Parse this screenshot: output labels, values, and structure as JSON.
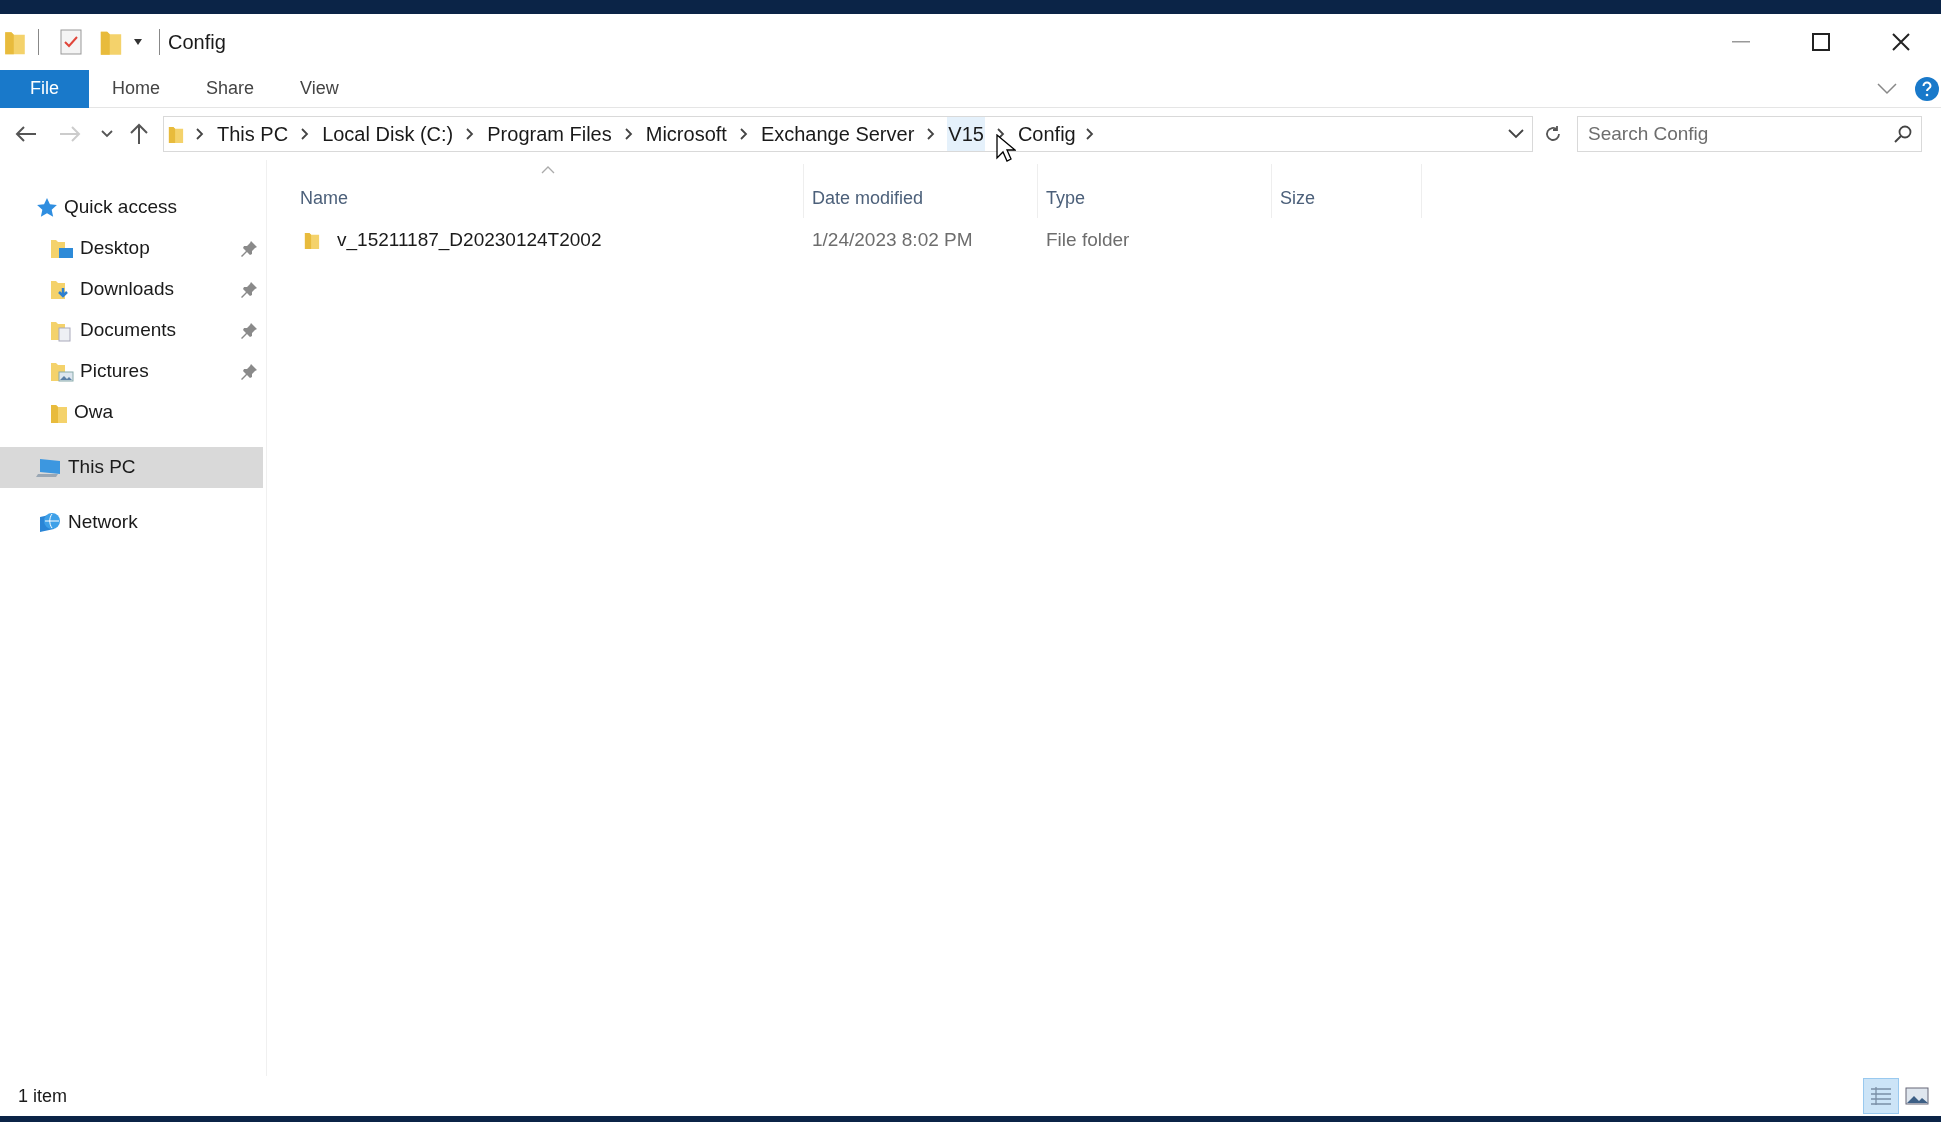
{
  "window": {
    "title": "Config"
  },
  "ribbon_tabs": [
    {
      "label": "File",
      "selected": true
    },
    {
      "label": "Home",
      "selected": false
    },
    {
      "label": "Share",
      "selected": false
    },
    {
      "label": "View",
      "selected": false
    }
  ],
  "address_bar": {
    "crumbs": [
      {
        "label": "This PC",
        "hovered": false
      },
      {
        "label": "Local Disk (C:)",
        "hovered": false
      },
      {
        "label": "Program Files",
        "hovered": false
      },
      {
        "label": "Microsoft",
        "hovered": false
      },
      {
        "label": "Exchange Server",
        "hovered": false
      },
      {
        "label": "V15",
        "hovered": true
      },
      {
        "label": "Config",
        "hovered": false
      }
    ],
    "search": {
      "placeholder": "Search Config"
    }
  },
  "sidebar": {
    "items": [
      {
        "label": "Quick access",
        "kind": "star",
        "selected": false,
        "children": [
          {
            "label": "Desktop",
            "kind": "desktop",
            "pinned": true,
            "selected": false
          },
          {
            "label": "Downloads",
            "kind": "downloads",
            "pinned": true,
            "selected": false
          },
          {
            "label": "Documents",
            "kind": "documents",
            "pinned": true,
            "selected": false
          },
          {
            "label": "Pictures",
            "kind": "pictures",
            "pinned": true,
            "selected": false
          },
          {
            "label": "Owa",
            "kind": "folder",
            "pinned": false,
            "selected": false
          }
        ]
      },
      {
        "label": "This PC",
        "kind": "pc",
        "selected": true
      },
      {
        "label": "Network",
        "kind": "network",
        "selected": false
      }
    ]
  },
  "file_list": {
    "columns": [
      {
        "label": "Name",
        "sorted": true
      },
      {
        "label": "Date modified",
        "sorted": false
      },
      {
        "label": "Type",
        "sorted": false
      },
      {
        "label": "Size",
        "sorted": false
      }
    ],
    "rows": [
      {
        "name": "v_15211187_D20230124T2002",
        "date_modified": "1/24/2023 8:02 PM",
        "type": "File folder"
      }
    ]
  },
  "status_bar": {
    "item_count": "1 item",
    "views": [
      {
        "kind": "details",
        "selected": true
      },
      {
        "kind": "tiles",
        "selected": false
      }
    ]
  }
}
